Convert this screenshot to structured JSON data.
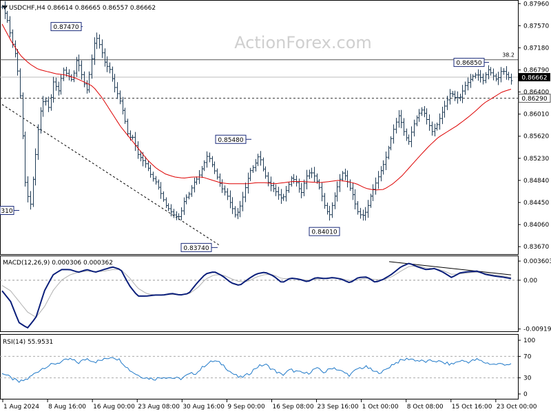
{
  "header": {
    "symbol_line": "USDCHF,H4  0.86614 0.86665 0.86557 0.86662",
    "watermark": "ActionForex.com"
  },
  "chart_data": [
    {
      "type": "ohlc",
      "title": "USDCHF,H4",
      "ylim": [
        0.8355,
        0.88
      ],
      "y_ticks": [
        "0.87960",
        "0.87570",
        "0.87180",
        "0.86790",
        "0.86400",
        "0.86010",
        "0.85620",
        "0.85230",
        "0.84840",
        "0.84450",
        "0.84060",
        "0.83670"
      ],
      "y_tick_values": [
        0.8796,
        0.8757,
        0.8718,
        0.8679,
        0.864,
        0.8601,
        0.8562,
        0.8523,
        0.8484,
        0.8445,
        0.8406,
        0.8367
      ],
      "current_price_label": "0.86662",
      "current_price": 0.86662,
      "level_label": "0.86290",
      "level_value": 0.8629,
      "fib_label": "38.2",
      "fib_value": 0.8697,
      "annotations": [
        {
          "text": "0.87470",
          "value": 0.8747
        },
        {
          "text": "0.86850",
          "value": 0.8685
        },
        {
          "text": "0.85480",
          "value": 0.8548
        },
        {
          "text": "0.84010",
          "value": 0.8401
        },
        {
          "text": "0.83740",
          "value": 0.8374
        },
        {
          "text": "310",
          "value": 0.8431
        }
      ],
      "ma_color": "#dd0000",
      "bar_color": "#1f3b55",
      "price_path": [
        0.879,
        0.877,
        0.873,
        0.87,
        0.862,
        0.847,
        0.844,
        0.852,
        0.86,
        0.863,
        0.861,
        0.866,
        0.864,
        0.868,
        0.867,
        0.866,
        0.87,
        0.867,
        0.864,
        0.869,
        0.874,
        0.872,
        0.869,
        0.868,
        0.865,
        0.863,
        0.86,
        0.856,
        0.856,
        0.853,
        0.852,
        0.851,
        0.849,
        0.848,
        0.846,
        0.844,
        0.843,
        0.842,
        0.842,
        0.845,
        0.846,
        0.848,
        0.849,
        0.851,
        0.853,
        0.851,
        0.849,
        0.847,
        0.846,
        0.844,
        0.842,
        0.844,
        0.847,
        0.85,
        0.851,
        0.853,
        0.85,
        0.848,
        0.847,
        0.846,
        0.845,
        0.847,
        0.849,
        0.848,
        0.846,
        0.849,
        0.85,
        0.849,
        0.847,
        0.844,
        0.842,
        0.845,
        0.848,
        0.85,
        0.848,
        0.846,
        0.843,
        0.842,
        0.843,
        0.846,
        0.848,
        0.85,
        0.852,
        0.855,
        0.858,
        0.86,
        0.857,
        0.855,
        0.858,
        0.86,
        0.861,
        0.859,
        0.857,
        0.858,
        0.86,
        0.862,
        0.864,
        0.863,
        0.863,
        0.865,
        0.866,
        0.867,
        0.867,
        0.866,
        0.868,
        0.867,
        0.866,
        0.868,
        0.867,
        0.866
      ],
      "ma_path": [
        0.876,
        0.873,
        0.8705,
        0.869,
        0.868,
        0.8676,
        0.8672,
        0.867,
        0.8665,
        0.8658,
        0.865,
        0.863,
        0.8605,
        0.858,
        0.856,
        0.854,
        0.852,
        0.8505,
        0.8495,
        0.849,
        0.8488,
        0.849,
        0.849,
        0.8485,
        0.848,
        0.8478,
        0.8478,
        0.8478,
        0.848,
        0.848,
        0.8478,
        0.848,
        0.8482,
        0.8482,
        0.8481,
        0.848,
        0.8482,
        0.8484,
        0.8482,
        0.8478,
        0.847,
        0.8467,
        0.8468,
        0.8478,
        0.8492,
        0.851,
        0.8528,
        0.8545,
        0.856,
        0.857,
        0.858,
        0.8592,
        0.8605,
        0.862,
        0.863,
        0.864,
        0.8645
      ],
      "trendline": {
        "from": 0.8618,
        "to": 0.837
      },
      "x_labels": [
        "1 Aug 2024",
        "8 Aug 16:00",
        "16 Aug 00:00",
        "23 Aug 08:00",
        "30 Aug 16:00",
        "9 Sep 00:00",
        "16 Sep 08:00",
        "23 Sep 16:00",
        "1 Oct 00:00",
        "8 Oct 08:00",
        "15 Oct 16:00",
        "23 Oct 00:00"
      ]
    },
    {
      "type": "line",
      "title": "MACD(12,26,9) 0.000306 0.000362",
      "ylim": [
        -0.0095,
        0.004
      ],
      "y_ticks": [
        "0.003603",
        "0.00",
        "-0.009198"
      ],
      "y_tick_values": [
        0.003603,
        0.0,
        -0.009198
      ],
      "series": [
        {
          "color": "#0a1e7a",
          "values": [
            -0.002,
            -0.004,
            -0.008,
            -0.009,
            -0.007,
            -0.002,
            0.001,
            0.002,
            0.002,
            0.0015,
            0.002,
            0.0015,
            0.002,
            0.0025,
            0.002,
            -0.001,
            -0.003,
            -0.003,
            -0.0028,
            -0.0028,
            -0.0025,
            -0.0028,
            -0.0025,
            -0.0005,
            0.0012,
            0.0016,
            0.0008,
            -0.0005,
            -0.001,
            0.0002,
            0.0012,
            0.0015,
            0.0008,
            -0.0005,
            0.0004,
            0.0002,
            -0.0003,
            0.0005,
            0.0003,
            0.0005,
            0.0002,
            -0.0005,
            0.0005,
            0.0006,
            -0.0004,
            0.0002,
            0.0012,
            0.0025,
            0.0032,
            0.0025,
            0.002,
            0.0022,
            0.0015,
            0.0005,
            0.0014,
            0.0016,
            0.0017,
            0.0011,
            0.0008,
            0.0006,
            0.0003
          ]
        },
        {
          "color": "#b0b0b0",
          "values": [
            -0.001,
            -0.002,
            -0.004,
            -0.006,
            -0.007,
            -0.005,
            -0.002,
            0.0,
            0.001,
            0.0015,
            0.0017,
            0.0016,
            0.0017,
            0.002,
            0.002,
            0.0005,
            -0.0015,
            -0.0025,
            -0.0028,
            -0.0028,
            -0.0027,
            -0.0027,
            -0.0026,
            -0.0015,
            0.0002,
            0.001,
            0.001,
            0.0003,
            -0.0003,
            -0.0002,
            0.0006,
            0.0011,
            0.001,
            0.0003,
            0.0003,
            0.0002,
            0.0,
            0.0002,
            0.0003,
            0.0004,
            0.0003,
            -0.0001,
            0.0001,
            0.0004,
            0.0001,
            0.0001,
            0.0007,
            0.0017,
            0.0026,
            0.0027,
            0.0023,
            0.0022,
            0.0018,
            0.0011,
            0.0012,
            0.0014,
            0.0015,
            0.0013,
            0.001,
            0.0008,
            0.0005
          ]
        }
      ],
      "trendline": {
        "from": 0.0035,
        "to": 0.001
      }
    },
    {
      "type": "line",
      "title": "RSI(14) 55.9531",
      "ylim": [
        0,
        100
      ],
      "y_ticks": [
        "100",
        "70",
        "30",
        "0"
      ],
      "y_tick_values": [
        100,
        70,
        30,
        0
      ],
      "series": [
        {
          "color": "#1e78c8",
          "values": [
            40,
            30,
            22,
            28,
            40,
            50,
            55,
            60,
            65,
            58,
            66,
            60,
            64,
            70,
            62,
            45,
            35,
            30,
            28,
            32,
            30,
            28,
            36,
            40,
            55,
            62,
            55,
            40,
            30,
            36,
            50,
            55,
            45,
            35,
            45,
            40,
            38,
            48,
            40,
            50,
            42,
            35,
            48,
            50,
            40,
            42,
            55,
            62,
            66,
            62,
            60,
            62,
            58,
            55,
            62,
            60,
            64,
            58,
            55,
            56,
            55
          ]
        }
      ]
    }
  ]
}
